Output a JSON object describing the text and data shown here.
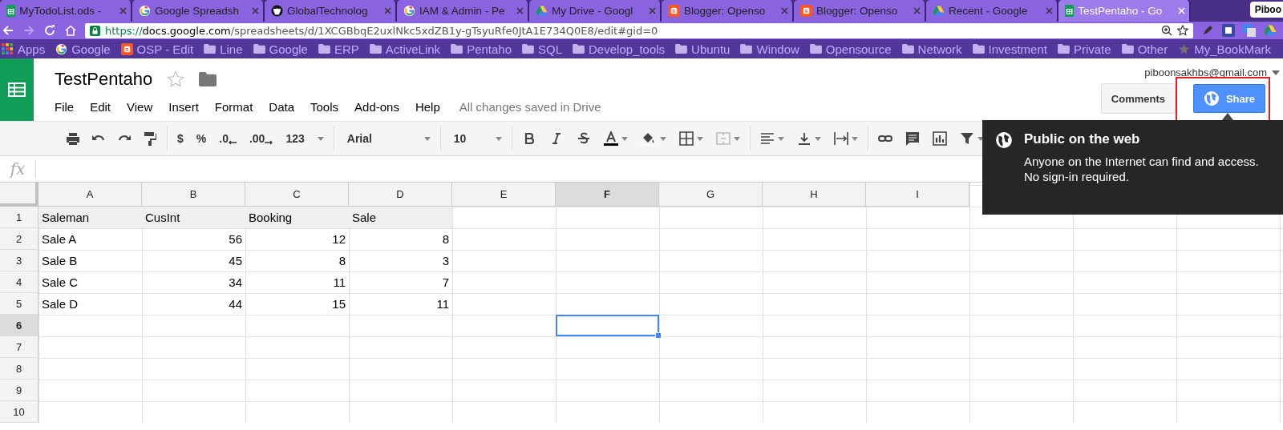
{
  "browser": {
    "tabs": [
      {
        "title": "MyTodoList.ods -",
        "kind": "sheets",
        "selected": false
      },
      {
        "title": "Google Spreadsh",
        "kind": "google",
        "selected": false
      },
      {
        "title": "GlobalTechnolog",
        "kind": "github",
        "selected": false
      },
      {
        "title": "IAM & Admin - Pe",
        "kind": "google",
        "selected": false
      },
      {
        "title": "My Drive - Googl",
        "kind": "drive",
        "selected": false
      },
      {
        "title": "Blogger: Openso",
        "kind": "blogger",
        "selected": false
      },
      {
        "title": "Blogger: Openso",
        "kind": "blogger",
        "selected": false
      },
      {
        "title": "Recent - Google",
        "kind": "drive",
        "selected": false
      },
      {
        "title": "TestPentaho - Go",
        "kind": "sheets",
        "selected": true
      }
    ],
    "profile": "Piboo",
    "url": {
      "scheme": "https://",
      "host": "docs.google.com",
      "path": "/spreadsheets/d/1XCGBbqE2uxlNkc5xdZB1y-gTsyuRfe0JtA1E734Q0E8/edit#gid=0"
    },
    "bookmarks": [
      {
        "label": "Apps",
        "kind": "apps"
      },
      {
        "label": "Google",
        "kind": "google"
      },
      {
        "label": "OSP - Edit",
        "kind": "blogger"
      },
      {
        "label": "Line",
        "kind": "folder"
      },
      {
        "label": "Google",
        "kind": "folder"
      },
      {
        "label": "ERP",
        "kind": "folder"
      },
      {
        "label": "ActiveLink",
        "kind": "folder"
      },
      {
        "label": "Pentaho",
        "kind": "folder"
      },
      {
        "label": "SQL",
        "kind": "folder"
      },
      {
        "label": "Develop_tools",
        "kind": "folder"
      },
      {
        "label": "Ubuntu",
        "kind": "folder"
      },
      {
        "label": "Window",
        "kind": "folder"
      },
      {
        "label": "Opensource",
        "kind": "folder"
      },
      {
        "label": "Network",
        "kind": "folder"
      },
      {
        "label": "Investment",
        "kind": "folder"
      },
      {
        "label": "Private",
        "kind": "folder"
      },
      {
        "label": "Other",
        "kind": "folder"
      },
      {
        "label": "My_BookMark",
        "kind": "star"
      }
    ]
  },
  "document": {
    "title": "TestPentaho",
    "menus": [
      "File",
      "Edit",
      "View",
      "Insert",
      "Format",
      "Data",
      "Tools",
      "Add-ons",
      "Help"
    ],
    "save_status": "All changes saved in Drive",
    "account": "piboonsakhbs@gmail.com",
    "comments_button": "Comments",
    "share_button": "Share"
  },
  "toolbar": {
    "number_formats": [
      "$",
      "%",
      ".0",
      ".00",
      "123"
    ],
    "font": "Arial",
    "font_size": "10"
  },
  "formula_bar": {
    "label": "fx"
  },
  "tooltip": {
    "title": "Public on the web",
    "lines": [
      "Anyone on the Internet can find and access.",
      "No sign-in required."
    ]
  },
  "sheet": {
    "columns": [
      {
        "label": "A",
        "selected": false
      },
      {
        "label": "B",
        "selected": false
      },
      {
        "label": "C",
        "selected": false
      },
      {
        "label": "D",
        "selected": false
      },
      {
        "label": "E",
        "selected": false
      },
      {
        "label": "F",
        "selected": true
      },
      {
        "label": "G",
        "selected": false
      },
      {
        "label": "H",
        "selected": false
      },
      {
        "label": "I",
        "selected": false
      }
    ],
    "rows": [
      {
        "number": "1",
        "selected": false,
        "kind": "header",
        "cells": [
          "Saleman",
          "CusInt",
          "Booking",
          "Sale"
        ]
      },
      {
        "number": "2",
        "selected": false,
        "kind": "data",
        "cells": [
          "Sale A",
          "56",
          "12",
          "8"
        ]
      },
      {
        "number": "3",
        "selected": false,
        "kind": "data",
        "cells": [
          "Sale B",
          "45",
          "8",
          "3"
        ]
      },
      {
        "number": "4",
        "selected": false,
        "kind": "data",
        "cells": [
          "Sale C",
          "34",
          "11",
          "7"
        ]
      },
      {
        "number": "5",
        "selected": false,
        "kind": "data",
        "cells": [
          "Sale D",
          "44",
          "15",
          "11"
        ]
      },
      {
        "number": "6",
        "selected": true,
        "kind": "data",
        "cells": []
      },
      {
        "number": "7",
        "selected": false,
        "kind": "data",
        "cells": []
      },
      {
        "number": "8",
        "selected": false,
        "kind": "data",
        "cells": []
      },
      {
        "number": "9",
        "selected": false,
        "kind": "data",
        "cells": []
      },
      {
        "number": "10",
        "selected": false,
        "kind": "data",
        "cells": []
      }
    ]
  }
}
